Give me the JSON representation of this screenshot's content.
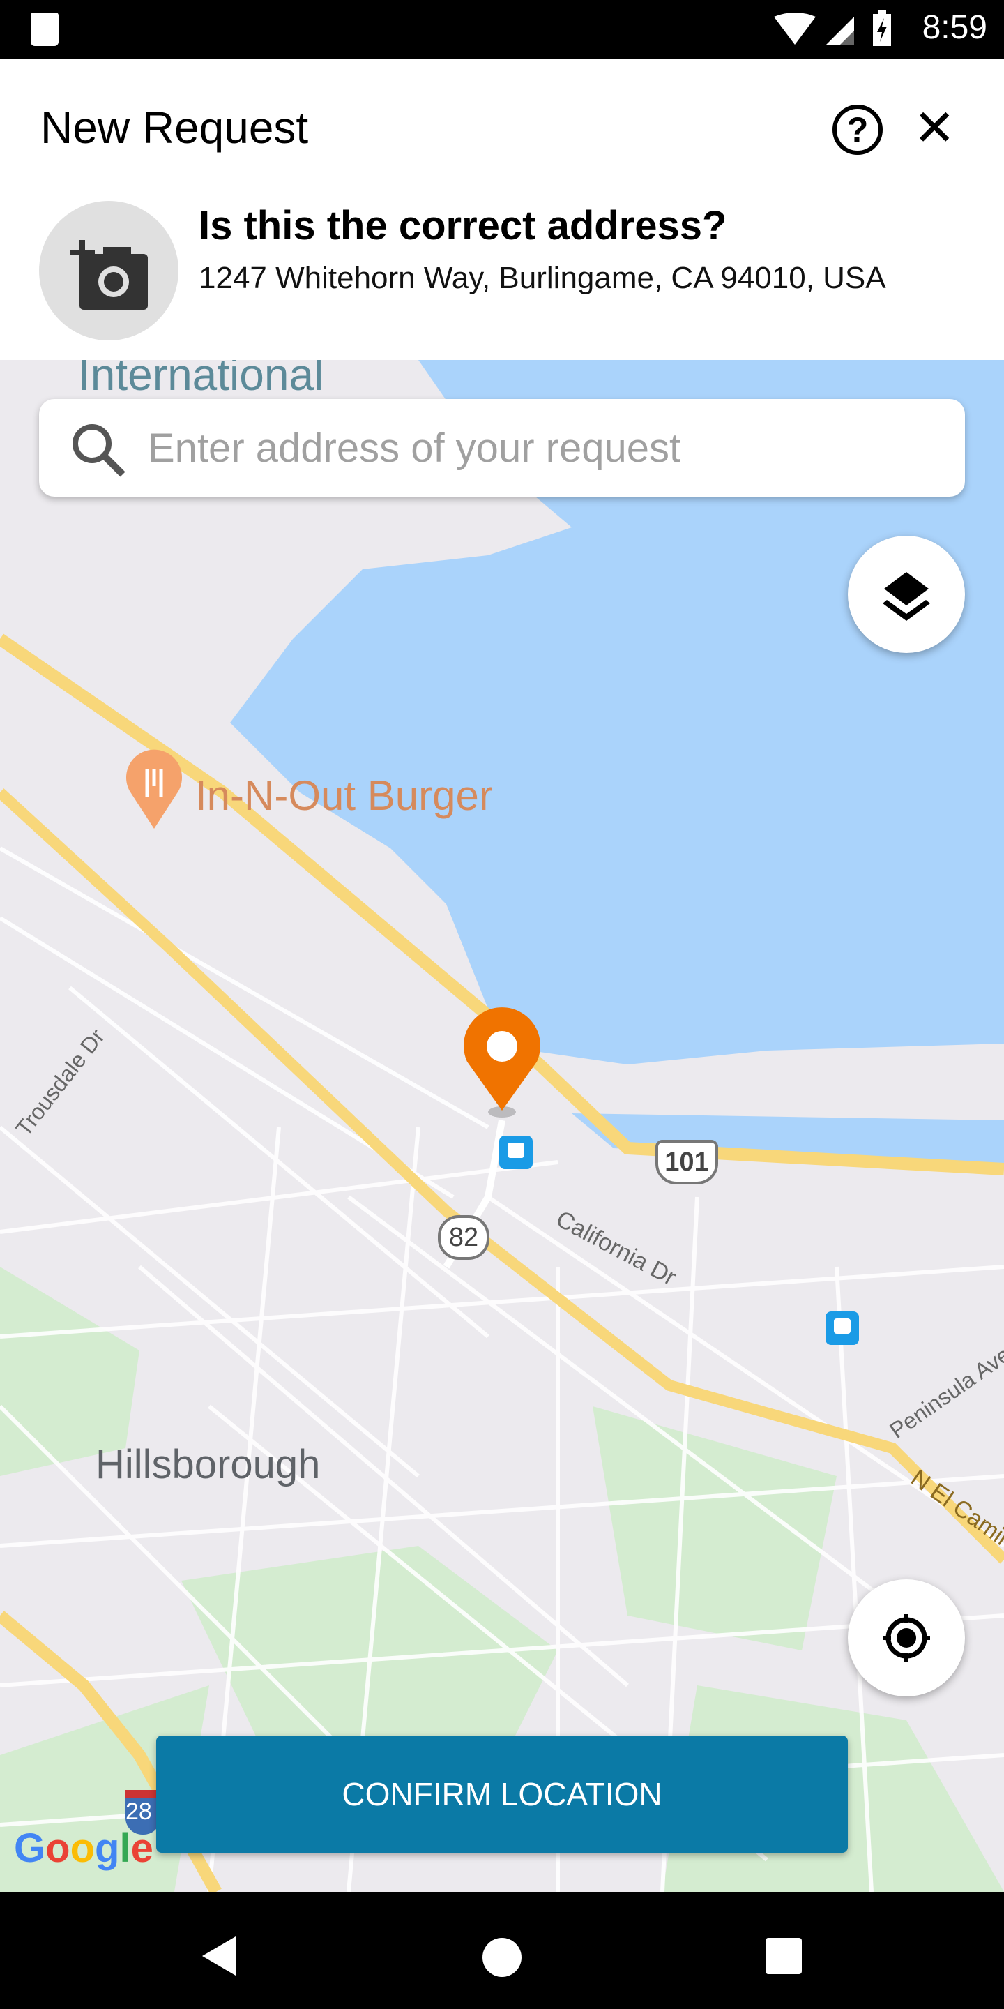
{
  "status_bar": {
    "time": "8:59",
    "icons": [
      "sd-card-icon",
      "wifi-icon",
      "signal-icon",
      "battery-charging-icon"
    ]
  },
  "header": {
    "title": "New Request",
    "help_icon": "help-circle-icon",
    "close_icon": "close-icon"
  },
  "address_card": {
    "question": "Is this the correct address?",
    "address": "1247 Whitehorn Way, Burlingame, CA 94010, USA",
    "photo_icon": "add-photo-icon"
  },
  "search": {
    "placeholder": "Enter address of your request",
    "value": ""
  },
  "map": {
    "labels": {
      "airport": "International",
      "restaurant": "In-N-Out Burger",
      "town": "Hillsborough",
      "street1": "California Dr",
      "street2": "Trousdale Dr",
      "street3": "Peninsula Ave",
      "street4": "N El Camin"
    },
    "shields": {
      "us101": "101",
      "ca82": "82",
      "i280": "28"
    },
    "attribution": "Google",
    "colors": {
      "water": "#aad3fb",
      "land": "#eceaee",
      "park": "#d4ecd0",
      "highway": "#f8d77a",
      "pin": "#f07300"
    }
  },
  "buttons": {
    "confirm": "CONFIRM LOCATION",
    "layers_icon": "layers-icon",
    "locate_icon": "my-location-icon"
  },
  "nav_bar": {
    "icons": [
      "back-icon",
      "home-icon",
      "recents-icon"
    ]
  }
}
